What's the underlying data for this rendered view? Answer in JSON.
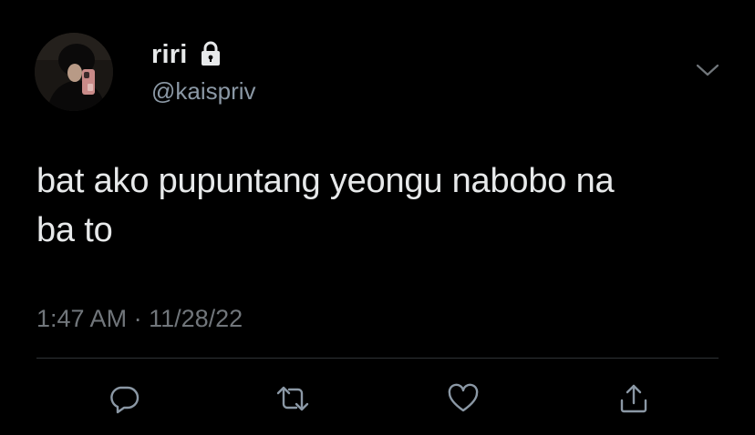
{
  "user": {
    "display_name": "riri",
    "handle": "@kaispriv",
    "protected_icon": "lock-icon",
    "avatar": "profile-avatar"
  },
  "tweet": {
    "text_line1": "bat ako pupuntang yeongu nabobo na",
    "text_line2": "ba to",
    "time": "1:47 AM",
    "separator": "·",
    "date": "11/28/22"
  },
  "actions": [
    {
      "name": "reply",
      "icon": "reply-icon"
    },
    {
      "name": "retweet",
      "icon": "retweet-icon"
    },
    {
      "name": "like",
      "icon": "heart-icon"
    },
    {
      "name": "share",
      "icon": "share-icon"
    }
  ],
  "menu_icon": "chevron-down-icon",
  "colors": {
    "background": "#000000",
    "text_primary": "#e7e9ea",
    "text_secondary": "#71767b",
    "divider": "#2f3336"
  }
}
